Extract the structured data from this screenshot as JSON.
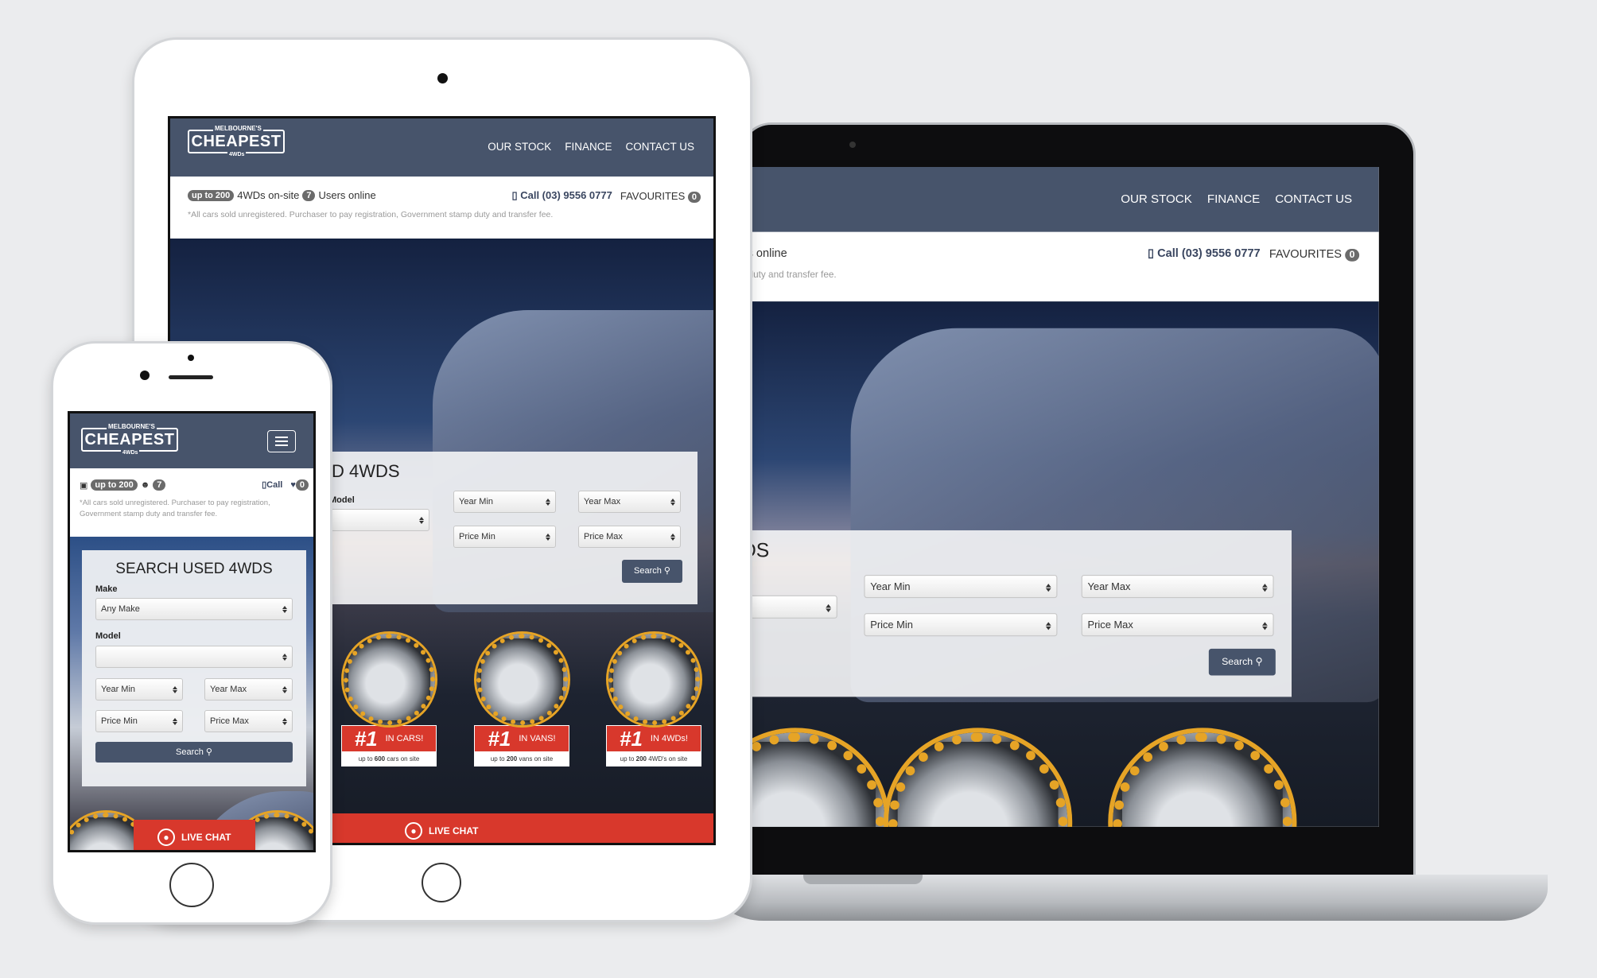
{
  "site": {
    "logo": {
      "top": "MELBOURNE'S",
      "main": "CHEAPEST",
      "sub": "4WDs"
    },
    "nav": [
      "OUR STOCK",
      "FINANCE",
      "CONTACT US"
    ],
    "info": {
      "stock_badge": "up to 200",
      "stock_label": "4WDs on-site",
      "users_badge": "7",
      "users_label": "Users online",
      "call": "Call (03) 9556 0777",
      "call_short": "Call",
      "favourites": "FAVOURITES",
      "fav_count": "0"
    },
    "disclaimer": "*All cars sold unregistered. Purchaser to pay registration, Government stamp duty and transfer fee.",
    "search": {
      "title": "SEARCH USED 4WDS",
      "make_label": "Make",
      "make_value": "Any Make",
      "model_label": "Model",
      "model_value": "",
      "year_min": "Year Min",
      "year_max": "Year Max",
      "price_min": "Price Min",
      "price_max": "Price Max",
      "button": "Search"
    },
    "badges": [
      {
        "rank": "#1",
        "label": "IN CARS!",
        "pre": "up to",
        "count": "600",
        "post": "cars on site"
      },
      {
        "rank": "#1",
        "label": "IN VANS!",
        "pre": "up to",
        "count": "200",
        "post": "vans on site"
      },
      {
        "rank": "#1",
        "label": "IN 4WDs!",
        "pre": "up to",
        "count": "200",
        "post": "4WD's on site"
      }
    ],
    "live_chat": "LIVE CHAT"
  },
  "colors": {
    "header": "#47546b",
    "accent_red": "#d8382c",
    "badge_gold": "#e6a426",
    "background": "#ebecee"
  },
  "icons": [
    "search-icon",
    "phone-icon",
    "heart-icon",
    "car-icon",
    "users-icon",
    "user-icon",
    "hamburger-menu-icon"
  ]
}
